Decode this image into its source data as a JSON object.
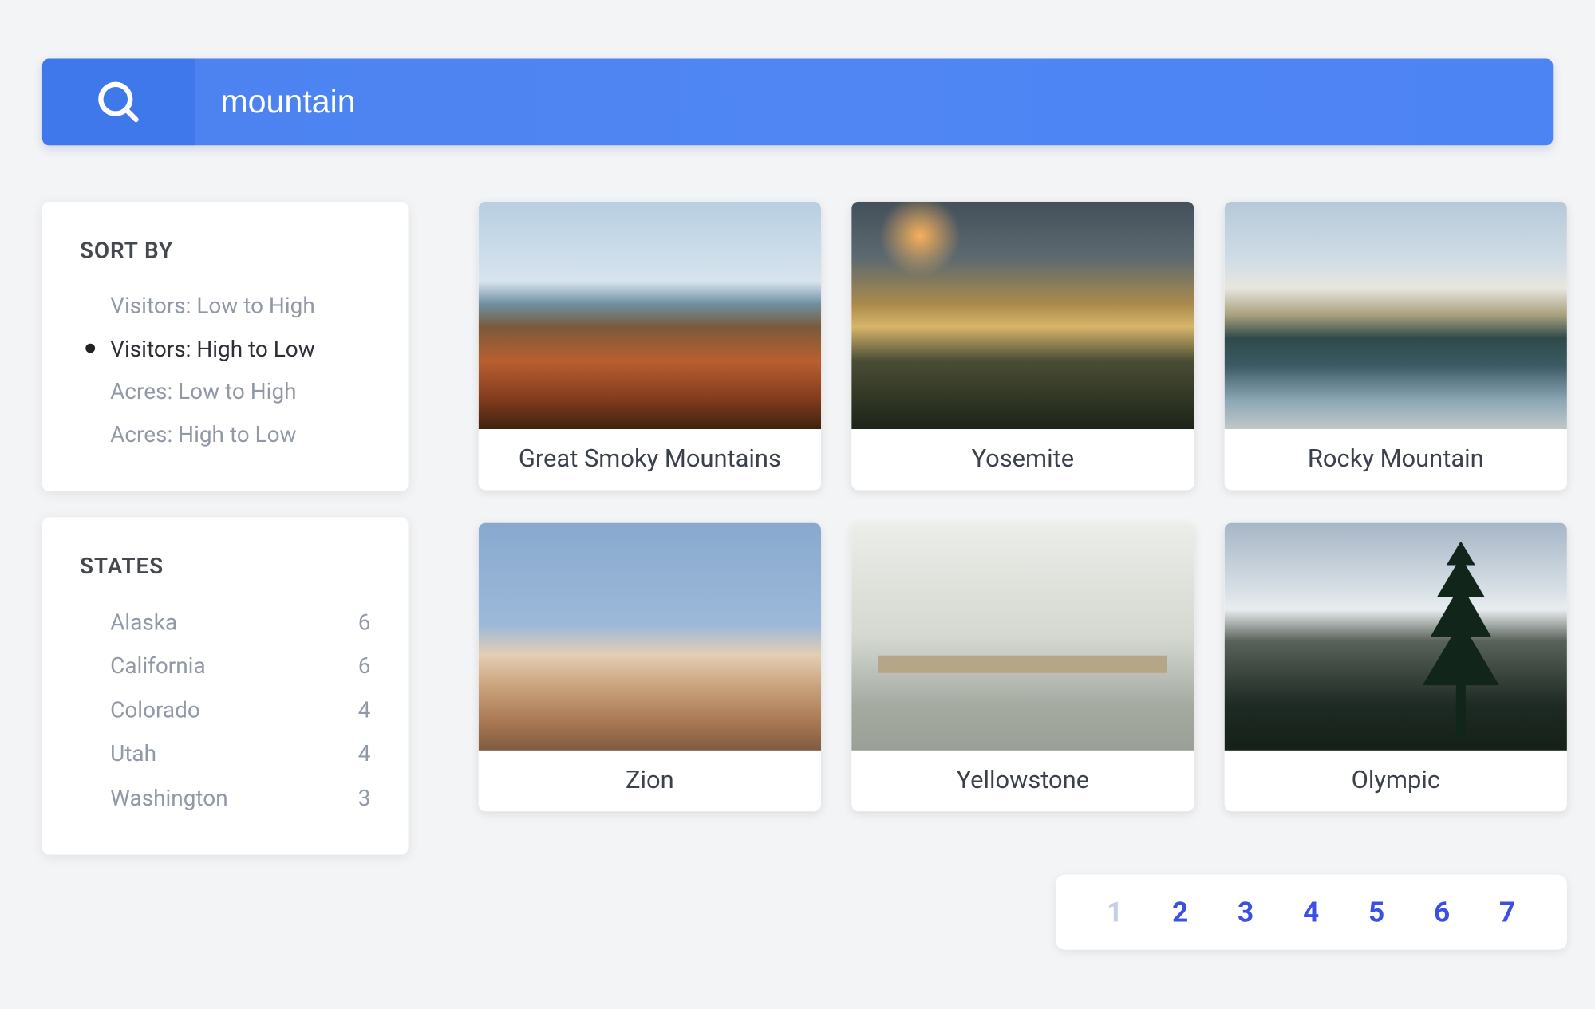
{
  "search": {
    "value": "mountain",
    "placeholder": ""
  },
  "sidebar": {
    "sort": {
      "title": "SORT BY",
      "options": [
        {
          "label": "Visitors: Low to High",
          "selected": false
        },
        {
          "label": "Visitors: High to Low",
          "selected": true
        },
        {
          "label": "Acres: Low to High",
          "selected": false
        },
        {
          "label": "Acres: High to Low",
          "selected": false
        }
      ]
    },
    "states": {
      "title": "STATES",
      "items": [
        {
          "name": "Alaska",
          "count": "6"
        },
        {
          "name": "California",
          "count": "6"
        },
        {
          "name": "Colorado",
          "count": "4"
        },
        {
          "name": "Utah",
          "count": "4"
        },
        {
          "name": "Washington",
          "count": "3"
        }
      ]
    }
  },
  "results": [
    {
      "title": "Great Smoky Mountains",
      "thumb": "t-smoky"
    },
    {
      "title": "Yosemite",
      "thumb": "t-yosemite"
    },
    {
      "title": "Rocky Mountain",
      "thumb": "t-rocky"
    },
    {
      "title": "Zion",
      "thumb": "t-zion"
    },
    {
      "title": "Yellowstone",
      "thumb": "t-yellowstone"
    },
    {
      "title": "Olympic",
      "thumb": "t-olympic"
    }
  ],
  "pagination": {
    "pages": [
      "1",
      "2",
      "3",
      "4",
      "5",
      "6",
      "7"
    ],
    "current": "1"
  }
}
